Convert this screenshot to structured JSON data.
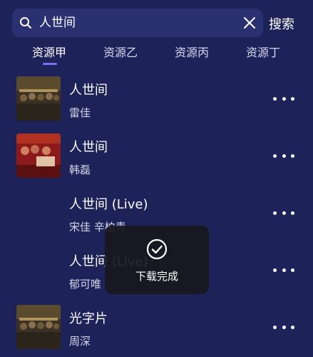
{
  "search": {
    "query": "人世间",
    "button_label": "搜索"
  },
  "tabs": [
    {
      "label": "资源甲",
      "active": true
    },
    {
      "label": "资源乙",
      "active": false
    },
    {
      "label": "资源丙",
      "active": false
    },
    {
      "label": "资源丁",
      "active": false
    }
  ],
  "songs": [
    {
      "title": "人世间",
      "artist": "雷佳",
      "cover": "ensemble-poster-gold"
    },
    {
      "title": "人世间",
      "artist": "韩磊",
      "cover": "ensemble-poster-red"
    },
    {
      "title": "人世间 (Live)",
      "artist": "宋佳 辛柏青",
      "cover": ""
    },
    {
      "title": "人世间 (Live)",
      "artist": "郁可唯",
      "cover": ""
    },
    {
      "title": "光字片",
      "artist": "周深",
      "cover": "ensemble-poster-gold"
    }
  ],
  "toast": {
    "message": "下载完成",
    "icon": "check-circle-icon"
  },
  "colors": {
    "background": "#1d2258",
    "search_box": "#2b3071",
    "tab_indicator": "#7f6df2"
  }
}
